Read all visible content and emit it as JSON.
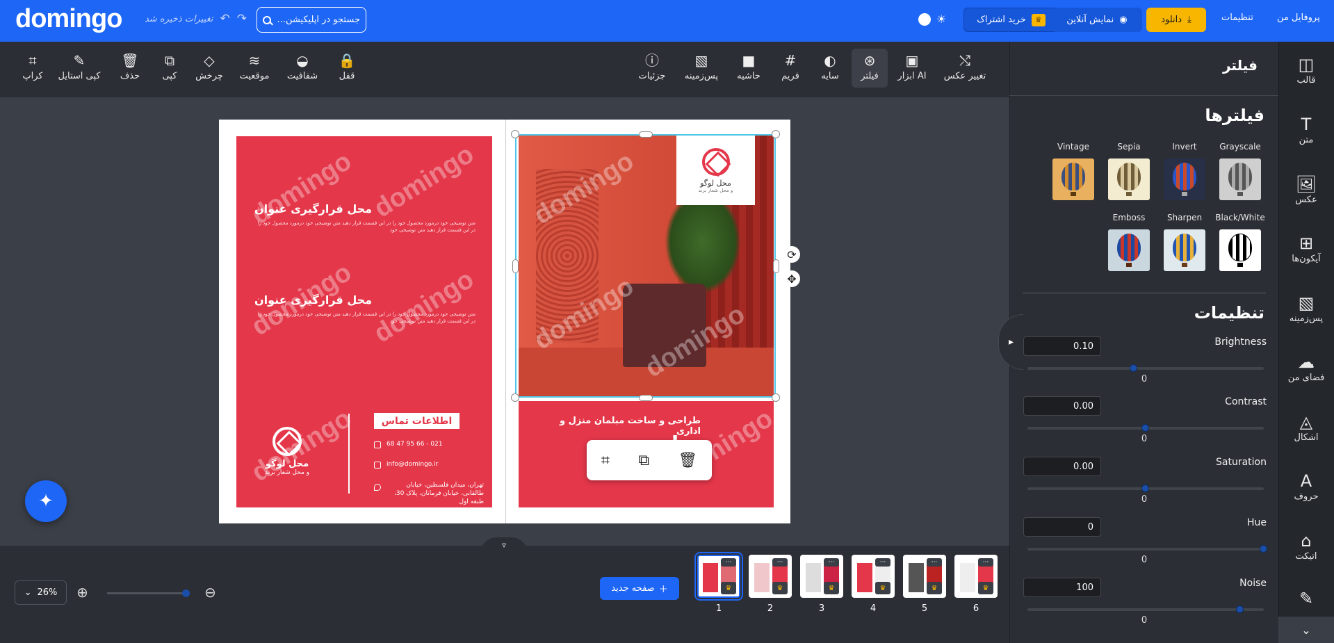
{
  "header": {
    "logo": "domingo",
    "save_status": "تغییرات ذخیره شد",
    "search_placeholder": "جستجو در اپلیکیشن...",
    "subscribe_label": "خرید اشتراک",
    "preview_label": "نمایش آنلاین",
    "download_label": "دانلود",
    "settings_link": "تنظیمات",
    "profile_link": "پروفایل من"
  },
  "toolbar": {
    "left_tools": [
      {
        "label": "کراپ",
        "icon": "crop-icon"
      },
      {
        "label": "کپی استایل",
        "icon": "brush-icon"
      },
      {
        "label": "حذف",
        "icon": "trash-icon"
      },
      {
        "label": "کپی",
        "icon": "copy-icon"
      },
      {
        "label": "چرخش",
        "icon": "rotate-icon"
      },
      {
        "label": "موقعیت",
        "icon": "layers-icon"
      },
      {
        "label": "شفافیت",
        "icon": "drop-icon"
      },
      {
        "label": "قفل",
        "icon": "lock-icon"
      }
    ],
    "right_tools": [
      {
        "label": "جزئیات",
        "icon": "info-icon"
      },
      {
        "label": "پس‌زمینه",
        "icon": "background-icon"
      },
      {
        "label": "حاشیه",
        "icon": "border-icon"
      },
      {
        "label": "فریم",
        "icon": "frame-icon"
      },
      {
        "label": "سایه",
        "icon": "shadow-icon"
      },
      {
        "label": "فیلتر",
        "icon": "filter-icon"
      },
      {
        "label": "ابزار AI",
        "icon": "ai-icon"
      },
      {
        "label": "تغییر عکس",
        "icon": "swap-image-icon"
      }
    ]
  },
  "sidebar": {
    "items": [
      {
        "label": "قالب",
        "icon": "template-icon"
      },
      {
        "label": "متن",
        "icon": "text-icon"
      },
      {
        "label": "عکس",
        "icon": "image-icon"
      },
      {
        "label": "آیکون‌ها",
        "icon": "icons-grid-icon"
      },
      {
        "label": "پس‌زمینه",
        "icon": "background-icon"
      },
      {
        "label": "فضای من",
        "icon": "cloud-upload-icon"
      },
      {
        "label": "اشکال",
        "icon": "shapes-icon"
      },
      {
        "label": "حروف",
        "icon": "letters-icon"
      },
      {
        "label": "اتیکت",
        "icon": "tag-icon"
      },
      {
        "label": "",
        "icon": "pen-icon"
      }
    ]
  },
  "panel": {
    "header": "فیلتر",
    "filters_title": "فیلترها",
    "filters": [
      {
        "name": "Grayscale"
      },
      {
        "name": "Invert"
      },
      {
        "name": "Sepia"
      },
      {
        "name": "Vintage"
      },
      {
        "name": "Black/White"
      },
      {
        "name": "Sharpen"
      },
      {
        "name": "Emboss"
      }
    ],
    "settings_title": "تنظیمات",
    "sliders": [
      {
        "label": "Brightness",
        "input": "0.10",
        "value": "0",
        "level": 0.45
      },
      {
        "label": "Contrast",
        "input": "0.00",
        "value": "0",
        "level": 0.5
      },
      {
        "label": "Saturation",
        "input": "0.00",
        "value": "0",
        "level": 0.5
      },
      {
        "label": "Hue",
        "input": "0",
        "value": "0",
        "level": 1.0
      },
      {
        "label": "Noise",
        "input": "100",
        "value": "0",
        "level": 0.9
      }
    ]
  },
  "canvas": {
    "watermark": "domingo",
    "heading1": "محل قرارگیری عنوان",
    "heading2": "محل قرارگیری عنوان",
    "body_text": "متن توضیحی خود درمورد محصول خود را در این قسمت قرار دهید متن توضیحی خود درمورد محصول خود را در این قسمت قرار دهید متن توضیحی خود",
    "contact_title": "اطلاعات تماس",
    "phone": "021 - 66 95 47 68",
    "email": "info@domingo.ir",
    "address": "تهران، میدان فلسطین، خیابان طالقانی، خیابان فرمانان، پلاک 30، طبقه اول",
    "left_logo_text": "محل لوگو",
    "left_logo_sub": "و محل شعار برند",
    "card_logo_text": "محل لوگو",
    "card_logo_sub": "و محل شعار برند",
    "right_title1": "طراحی و ساخت مبلمان منزل و اداری",
    "right_title2": "مبل چوب"
  },
  "bottom": {
    "zoom": "26%",
    "new_page_label": "صفحه جدید",
    "pages": [
      "1",
      "2",
      "3",
      "4",
      "5",
      "6"
    ],
    "active_page": "1"
  }
}
